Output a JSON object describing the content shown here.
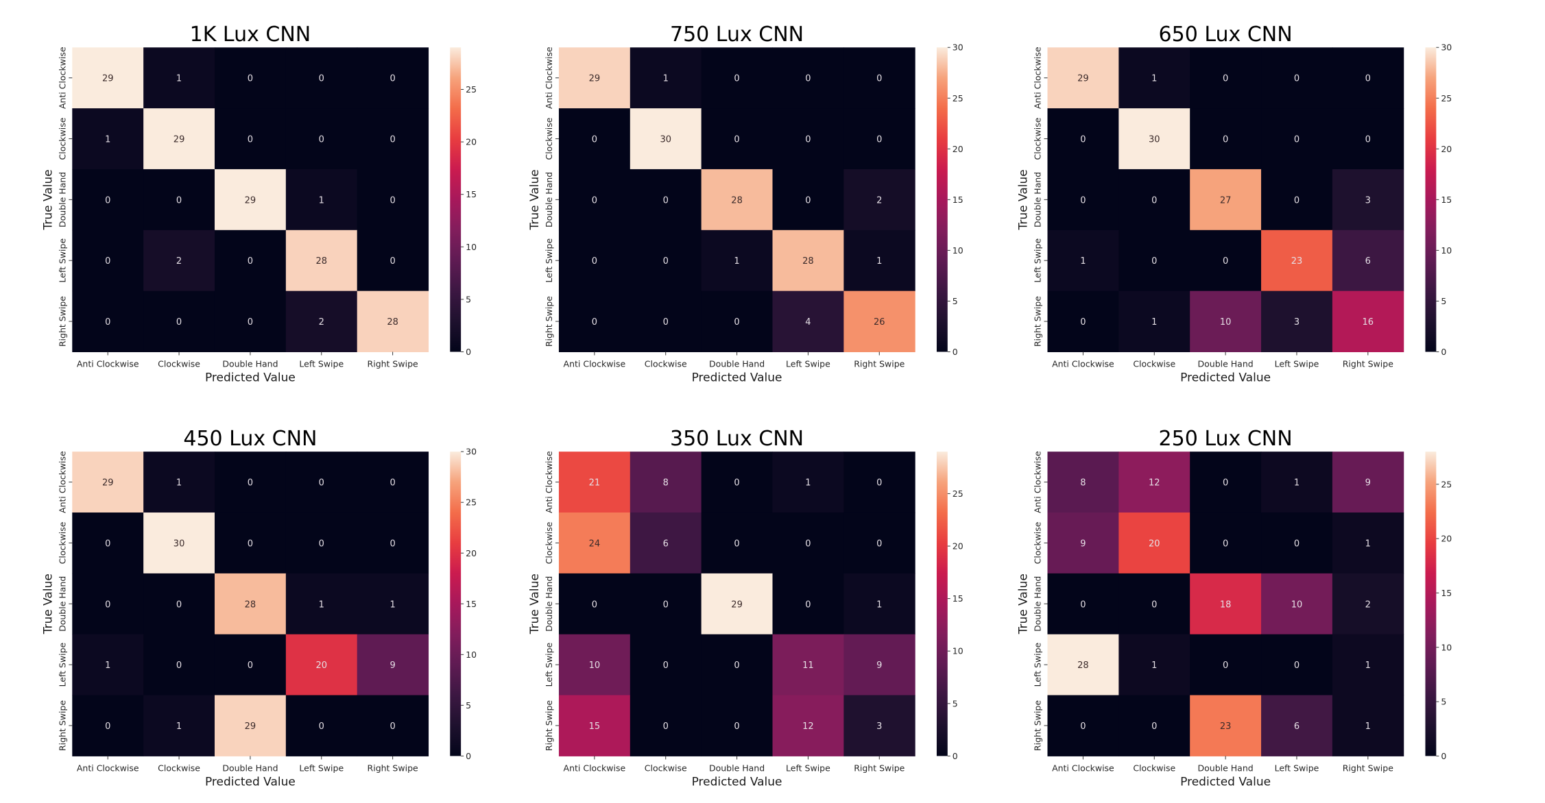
{
  "chart_data": [
    {
      "type": "heatmap",
      "title": "1K Lux CNN",
      "xlabel": "Predicted Value",
      "ylabel": "True Value",
      "x_categories": [
        "Anti Clockwise",
        "Clockwise",
        "Double Hand",
        "Left Swipe",
        "Right Swipe"
      ],
      "y_categories": [
        "Anti Clockwise",
        "Clockwise",
        "Double Hand",
        "Left Swipe",
        "Right Swipe"
      ],
      "values": [
        [
          29,
          1,
          0,
          0,
          0
        ],
        [
          1,
          29,
          0,
          0,
          0
        ],
        [
          0,
          0,
          29,
          1,
          0
        ],
        [
          0,
          2,
          0,
          28,
          0
        ],
        [
          0,
          0,
          0,
          2,
          28
        ]
      ],
      "colorbar": {
        "range": [
          0,
          29
        ],
        "ticks": [
          0,
          5,
          10,
          15,
          20,
          25
        ]
      },
      "colormap": "rocket"
    },
    {
      "type": "heatmap",
      "title": "750 Lux CNN",
      "xlabel": "Predicted Value",
      "ylabel": "True Value",
      "x_categories": [
        "Anti Clockwise",
        "Clockwise",
        "Double Hand",
        "Left Swipe",
        "Right Swipe"
      ],
      "y_categories": [
        "Anti Clockwise",
        "Clockwise",
        "Double Hand",
        "Left Swipe",
        "Right Swipe"
      ],
      "values": [
        [
          29,
          1,
          0,
          0,
          0
        ],
        [
          0,
          30,
          0,
          0,
          0
        ],
        [
          0,
          0,
          28,
          0,
          2
        ],
        [
          0,
          0,
          1,
          28,
          1
        ],
        [
          0,
          0,
          0,
          4,
          26
        ]
      ],
      "colorbar": {
        "range": [
          0,
          30
        ],
        "ticks": [
          0,
          5,
          10,
          15,
          20,
          25,
          30
        ]
      },
      "colormap": "rocket"
    },
    {
      "type": "heatmap",
      "title": "650 Lux CNN",
      "xlabel": "Predicted Value",
      "ylabel": "True Value",
      "x_categories": [
        "Anti Clockwise",
        "Clockwise",
        "Double Hand",
        "Left Swipe",
        "Right Swipe"
      ],
      "y_categories": [
        "Anti Clockwise",
        "Clockwise",
        "Double Hand",
        "Left Swipe",
        "Right Swipe"
      ],
      "values": [
        [
          29,
          1,
          0,
          0,
          0
        ],
        [
          0,
          30,
          0,
          0,
          0
        ],
        [
          0,
          0,
          27,
          0,
          3
        ],
        [
          1,
          0,
          0,
          23,
          6
        ],
        [
          0,
          1,
          10,
          3,
          16
        ]
      ],
      "colorbar": {
        "range": [
          0,
          30
        ],
        "ticks": [
          0,
          5,
          10,
          15,
          20,
          25,
          30
        ]
      },
      "colormap": "rocket"
    },
    {
      "type": "heatmap",
      "title": "450 Lux CNN",
      "xlabel": "Predicted Value",
      "ylabel": "True Value",
      "x_categories": [
        "Anti Clockwise",
        "Clockwise",
        "Double Hand",
        "Left Swipe",
        "Right Swipe"
      ],
      "y_categories": [
        "Anti Clockwise",
        "Clockwise",
        "Double Hand",
        "Left Swipe",
        "Right Swipe"
      ],
      "values": [
        [
          29,
          1,
          0,
          0,
          0
        ],
        [
          0,
          30,
          0,
          0,
          0
        ],
        [
          0,
          0,
          28,
          1,
          1
        ],
        [
          1,
          0,
          0,
          20,
          9
        ],
        [
          0,
          1,
          29,
          0,
          0
        ]
      ],
      "colorbar": {
        "range": [
          0,
          30
        ],
        "ticks": [
          0,
          5,
          10,
          15,
          20,
          25,
          30
        ]
      },
      "colormap": "rocket"
    },
    {
      "type": "heatmap",
      "title": "350 Lux CNN",
      "xlabel": "Predicted Value",
      "ylabel": "True Value",
      "x_categories": [
        "Anti Clockwise",
        "Clockwise",
        "Double Hand",
        "Left Swipe",
        "Right Swipe"
      ],
      "y_categories": [
        "Anti Clockwise",
        "Clockwise",
        "Double Hand",
        "Left Swipe",
        "Right Swipe"
      ],
      "values": [
        [
          21,
          8,
          0,
          1,
          0
        ],
        [
          24,
          6,
          0,
          0,
          0
        ],
        [
          0,
          0,
          29,
          0,
          1
        ],
        [
          10,
          0,
          0,
          11,
          9
        ],
        [
          15,
          0,
          0,
          12,
          3
        ]
      ],
      "colorbar": {
        "range": [
          0,
          29
        ],
        "ticks": [
          0,
          5,
          10,
          15,
          20,
          25
        ]
      },
      "colormap": "rocket"
    },
    {
      "type": "heatmap",
      "title": "250 Lux CNN",
      "xlabel": "Predicted Value",
      "ylabel": "True Value",
      "x_categories": [
        "Anti Clockwise",
        "Clockwise",
        "Double Hand",
        "Left Swipe",
        "Right Swipe"
      ],
      "y_categories": [
        "Anti Clockwise",
        "Clockwise",
        "Double Hand",
        "Left Swipe",
        "Right Swipe"
      ],
      "values": [
        [
          8,
          12,
          0,
          1,
          9
        ],
        [
          9,
          20,
          0,
          0,
          1
        ],
        [
          0,
          0,
          18,
          10,
          2
        ],
        [
          28,
          1,
          0,
          0,
          1
        ],
        [
          0,
          0,
          23,
          6,
          1
        ]
      ],
      "colorbar": {
        "range": [
          0,
          28
        ],
        "ticks": [
          0,
          5,
          10,
          15,
          20,
          25
        ]
      },
      "colormap": "rocket"
    }
  ]
}
